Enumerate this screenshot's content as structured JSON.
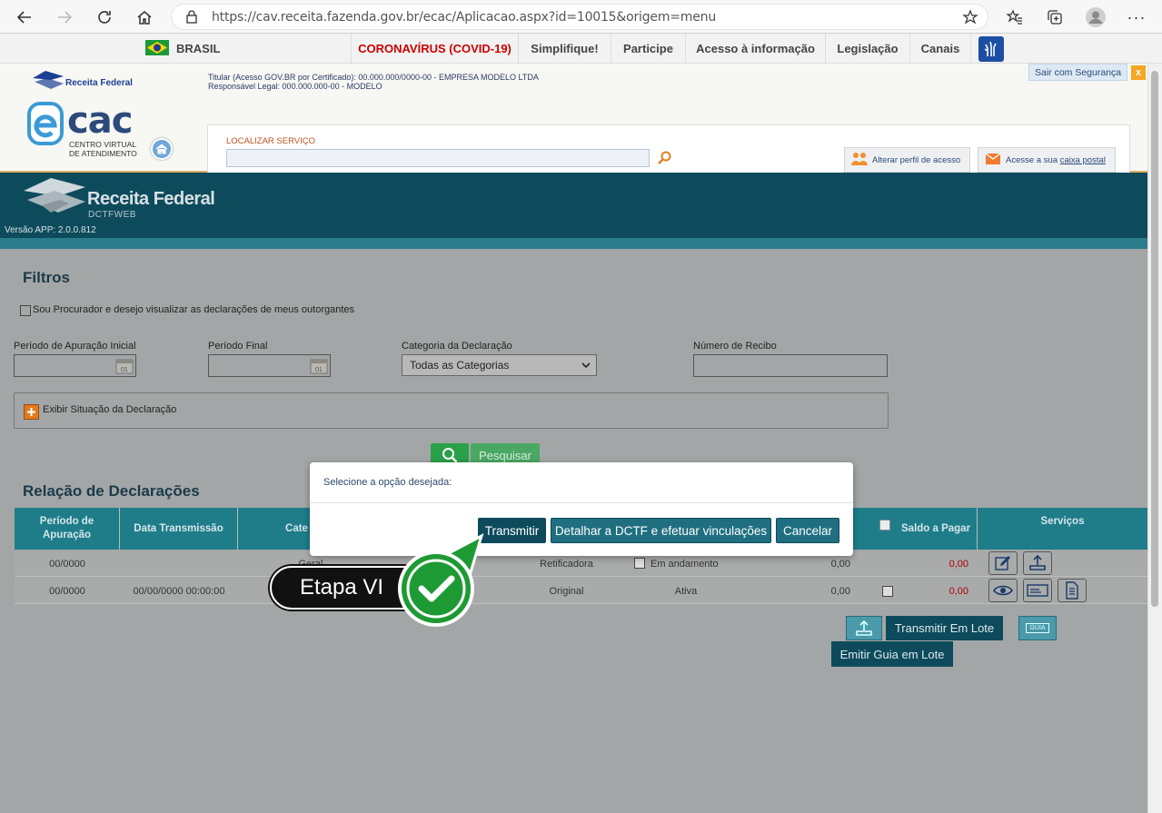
{
  "browser": {
    "url": "https://cav.receita.fazenda.gov.br/ecac/Aplicacao.aspx?id=10015&origem=menu"
  },
  "gov_bar": {
    "country": "BRASIL",
    "items": [
      "CORONAVÍRUS (COVID-19)",
      "Simplifique!",
      "Participe",
      "Acesso à informação",
      "Legislação",
      "Canais"
    ]
  },
  "ecac": {
    "brand_small": "Receita Federal",
    "logo_text": "cac",
    "logo_sub1": "CENTRO VIRTUAL",
    "logo_sub2": "DE ATENDIMENTO",
    "titular": "Titular (Acesso GOV.BR por Certificado): 00.000.000/0000-00 - EMPRESA MODELO LTDA",
    "responsavel": "Responsável Legal: 000.000.000-00 - MODELO",
    "logout": "Sair com Segurança",
    "search_label": "LOCALIZAR SERVIÇO",
    "change_profile": "Alterar perfil de acesso",
    "mailbox_prefix": "Acesse a sua",
    "mailbox_link": "caixa postal"
  },
  "app": {
    "title": "Receita Federal",
    "subtitle": "DCTFWEB",
    "version": "Versão APP: 2.0.0.812"
  },
  "filters": {
    "heading": "Filtros",
    "procurador": "Sou Procurador e desejo visualizar as declarações de meus outorgantes",
    "periodo_inicial": "Período de Apuração Inicial",
    "periodo_final": "Período Final",
    "categoria": "Categoria da Declaração",
    "categoria_value": "Todas as Categorias",
    "recibo": "Número de Recibo",
    "situacao": "Exibir Situação da Declaração",
    "search_btn": "Pesquisar",
    "cal_day": "01"
  },
  "table": {
    "heading": "Relação de Declarações",
    "headers": [
      "Período de Apuração",
      "Data Transmissão",
      "Cate",
      "Saldo a Pagar",
      "Serviços"
    ],
    "rows": [
      {
        "periodo": "00/0000",
        "data": "",
        "categoria": "Geral",
        "tipo": "Retificadora",
        "situacao": "Em andamento",
        "valor": "0,00",
        "saldo": "0,00"
      },
      {
        "periodo": "00/0000",
        "data": "00/00/0000 00:00:00",
        "categoria": "",
        "tipo": "Original",
        "situacao": "Ativa",
        "valor": "0,00",
        "saldo": "0,00"
      }
    ],
    "lote_transmit": "Transmitir Em Lote",
    "lote_guia": "Emitir Guia em Lote",
    "guia_icon_text": "GUIA"
  },
  "dialog": {
    "message": "Selecione a opção desejada:",
    "btn_transmit": "Transmitir",
    "btn_detail": "Detalhar a DCTF e efetuar vinculações",
    "btn_cancel": "Cancelar"
  },
  "callout": {
    "label": "Etapa VI"
  },
  "colors": {
    "accent_teal": "#1f7d8a",
    "header_dark": "#0d4b5c",
    "callout_green": "#22a83a",
    "covid_red": "#cc0000"
  }
}
